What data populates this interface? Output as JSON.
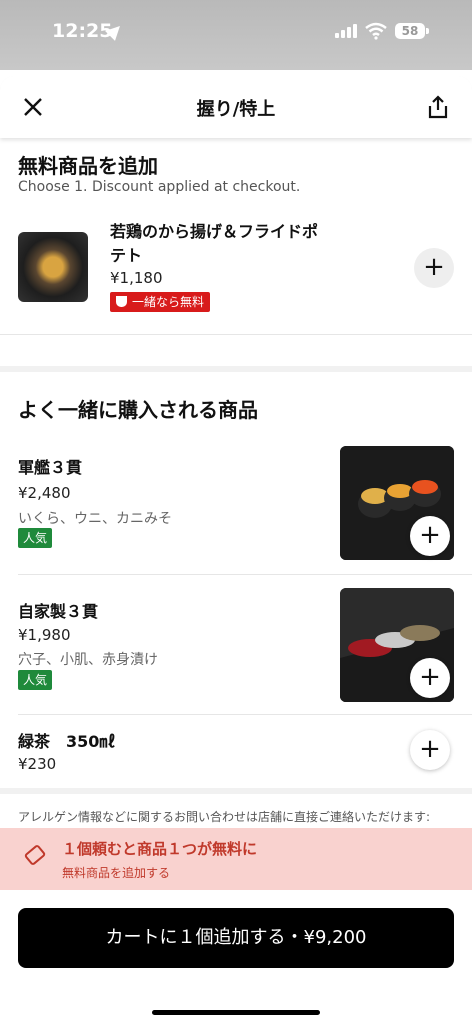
{
  "status_bar": {
    "time": "12:25",
    "battery": "58"
  },
  "header": {
    "title": "握り/特上"
  },
  "free_section": {
    "title": "無料商品を追加",
    "subtitle": "Choose 1. Discount applied at checkout.",
    "item": {
      "name_line1": "若鶏のから揚げ＆フライドポ",
      "name_line2": "テト",
      "price": "¥1,180",
      "badge": "一緒なら無料"
    }
  },
  "bought_together": {
    "title": "よく一緒に購入される商品",
    "items": [
      {
        "name": "軍艦３貫",
        "price": "¥2,480",
        "desc": "いくら、ウニ、カニみそ",
        "badge": "人気"
      },
      {
        "name": "自家製３貫",
        "price": "¥1,980",
        "desc": "穴子、小肌、赤身漬け",
        "badge": "人気"
      },
      {
        "name": "緑茶　350㎖",
        "price": "¥230"
      }
    ]
  },
  "allergy_note": "アレルゲン情報などに関するお問い合わせは店舗に直接ご連絡いただけます:",
  "promo": {
    "title": "１個頼むと商品１つが無料に",
    "subtitle": "無料商品を追加する"
  },
  "add_to_cart": "カートに１個追加する・¥9,200",
  "colors": {
    "badge_red": "#d81b1b",
    "popular_green": "#1f8a3b",
    "promo_bg": "#f9d2cf",
    "promo_text": "#c0392b"
  }
}
